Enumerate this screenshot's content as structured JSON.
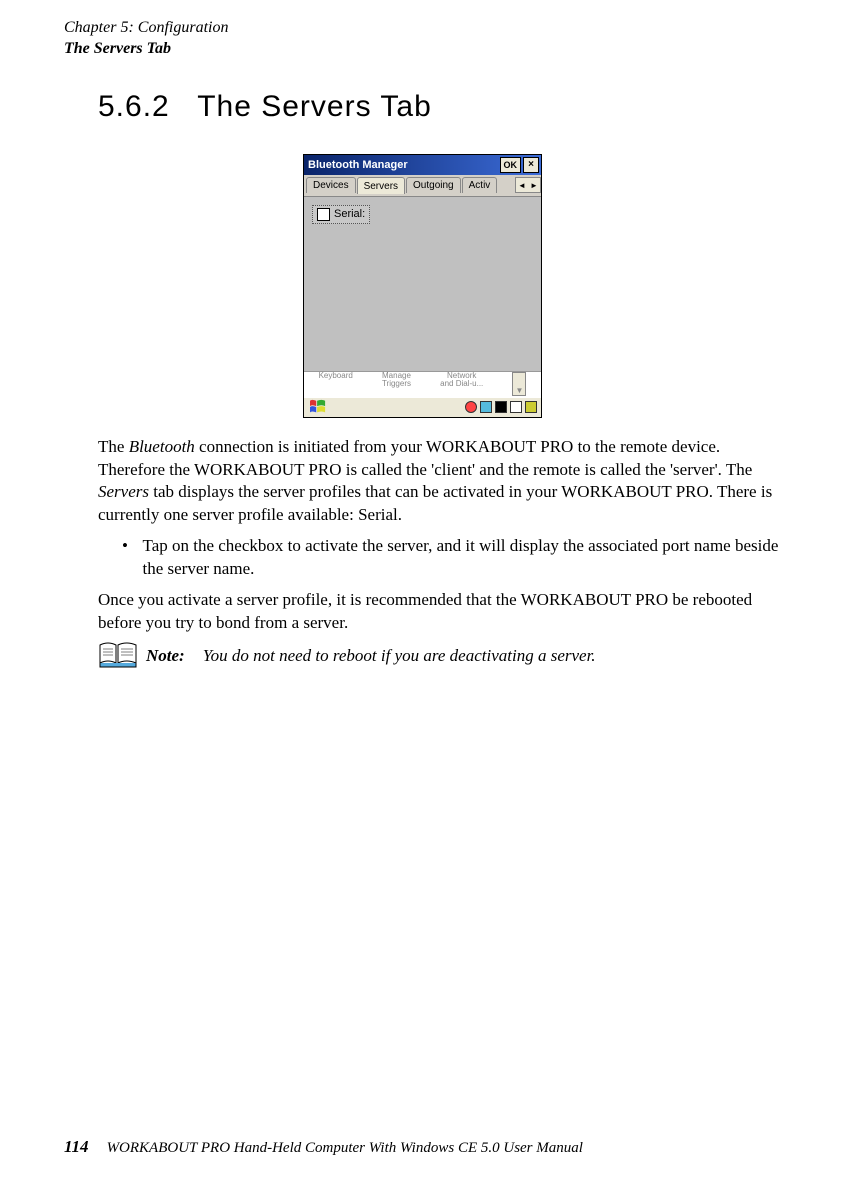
{
  "header": {
    "chapter": "Chapter 5: Configuration",
    "section": "The Servers Tab"
  },
  "heading": {
    "number": "5.6.2",
    "title": "The Servers Tab"
  },
  "window": {
    "title": "Bluetooth Manager",
    "ok_label": "OK",
    "close_label": "×",
    "tabs": {
      "devices": "Devices",
      "servers": "Servers",
      "outgoing": "Outgoing",
      "active": "Activ"
    },
    "arrows": {
      "left": "◄",
      "right": "►"
    },
    "serial_label": "Serial:",
    "subbar": {
      "item1_line1": "Keyboard",
      "item2_line1": "Manage",
      "item2_line2": "Triggers",
      "item3_line1": "Network",
      "item3_line2": "and Dial-u..."
    },
    "scroll_down": "▼"
  },
  "body": {
    "p1_a": "The ",
    "p1_b": "Bluetooth",
    "p1_c": " connection is initiated from your WORKABOUT PRO to the remote device. Therefore the WORKABOUT PRO is called the 'client' and the remote is called the 'server'. The ",
    "p1_d": "Servers",
    "p1_e": " tab displays the server profiles that can be activated in your WORKABOUT PRO. There is currently one server profile available: Serial.",
    "bullet_mark": "•",
    "bullet": "Tap on the checkbox to activate the server, and it will display the associated port name beside the server name.",
    "p2": "Once you activate a server profile, it is recommended that the WORKABOUT PRO be rebooted before you try to bond from a server.",
    "note_label": "Note:",
    "note_body": "You do not need to reboot if you are deactivating a server."
  },
  "footer": {
    "page": "114",
    "text": "WORKABOUT PRO Hand-Held Computer With Windows CE 5.0 User Manual"
  }
}
